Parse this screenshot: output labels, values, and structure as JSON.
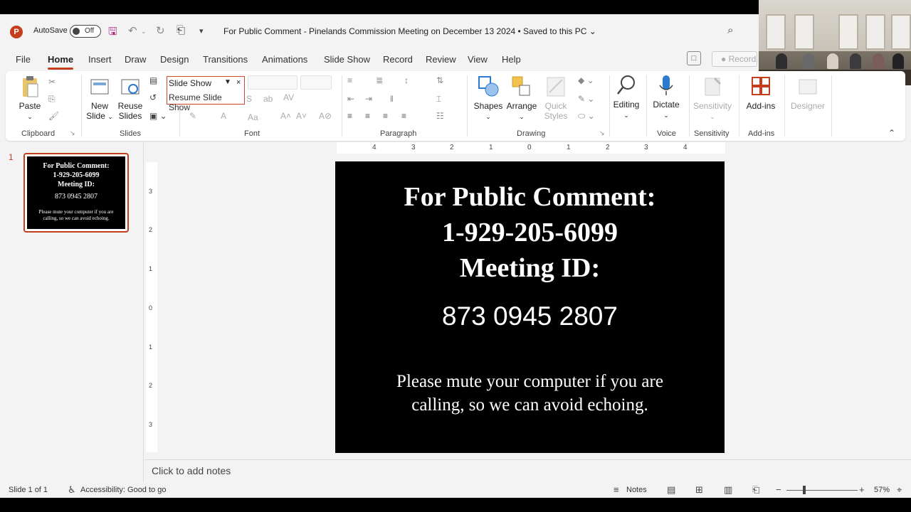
{
  "titlebar": {
    "app_logo": "P",
    "autosave_label": "AutoSave",
    "autosave_state": "Off",
    "doc_title": "For Public Comment - Pinelands Commission Meeting on December 13 2024 • Saved to this PC ⌄",
    "icons": [
      "save-icon",
      "undo-icon",
      "redo-icon",
      "present-icon",
      "customize-icon",
      "search-icon"
    ]
  },
  "menu": {
    "items": [
      "File",
      "Home",
      "Insert",
      "Draw",
      "Design",
      "Transitions",
      "Animations",
      "Slide Show",
      "Record",
      "Review",
      "View",
      "Help"
    ],
    "active": "Home",
    "record_label": "Record"
  },
  "ribbon": {
    "clipboard": {
      "paste": "Paste",
      "group": "Clipboard"
    },
    "slides": {
      "new_slide": "New",
      "new_slide2": "Slide",
      "reuse": "Reuse",
      "reuse2": "Slides",
      "group": "Slides"
    },
    "popup": {
      "slideshow": "Slide Show",
      "resume": "Resume Slide Show"
    },
    "font": {
      "group": "Font"
    },
    "paragraph": {
      "group": "Paragraph"
    },
    "drawing": {
      "shapes": "Shapes",
      "arrange": "Arrange",
      "quick": "Quick",
      "styles": "Styles",
      "group": "Drawing"
    },
    "editing": {
      "label": "Editing"
    },
    "voice": {
      "dictate": "Dictate",
      "group": "Voice"
    },
    "sensitivity": {
      "label": "Sensitivity",
      "group": "Sensitivity"
    },
    "addins": {
      "label": "Add-ins",
      "group": "Add-ins"
    },
    "designer": {
      "label": "Designer"
    }
  },
  "thumbnail": {
    "number": "1",
    "title1": "For Public Comment:",
    "title2": "1-929-205-6099",
    "title3": "Meeting ID:",
    "id": "873 0945 2807",
    "note": "Please mute your computer if you are calling, so we can avoid echoing."
  },
  "ruler": {
    "h_ticks": [
      "4",
      "3",
      "2",
      "1",
      "0",
      "1",
      "2",
      "3",
      "4"
    ],
    "v_ticks": [
      "3",
      "2",
      "1",
      "0",
      "1",
      "2",
      "3"
    ]
  },
  "slide": {
    "line1": "For Public Comment:",
    "line2": "1-929-205-6099",
    "line3": "Meeting ID:",
    "meeting_id": "873 0945 2807",
    "note": "Please mute your computer if you are calling, so we can avoid echoing."
  },
  "notes": {
    "placeholder": "Click to add notes"
  },
  "status": {
    "slide_of": "Slide 1 of 1",
    "accessibility": "Accessibility: Good to go",
    "notes": "Notes",
    "zoom": "57%"
  },
  "colors": {
    "accent": "#c43e1c",
    "slide_bg": "#000000",
    "popup_border": "#d24726"
  }
}
